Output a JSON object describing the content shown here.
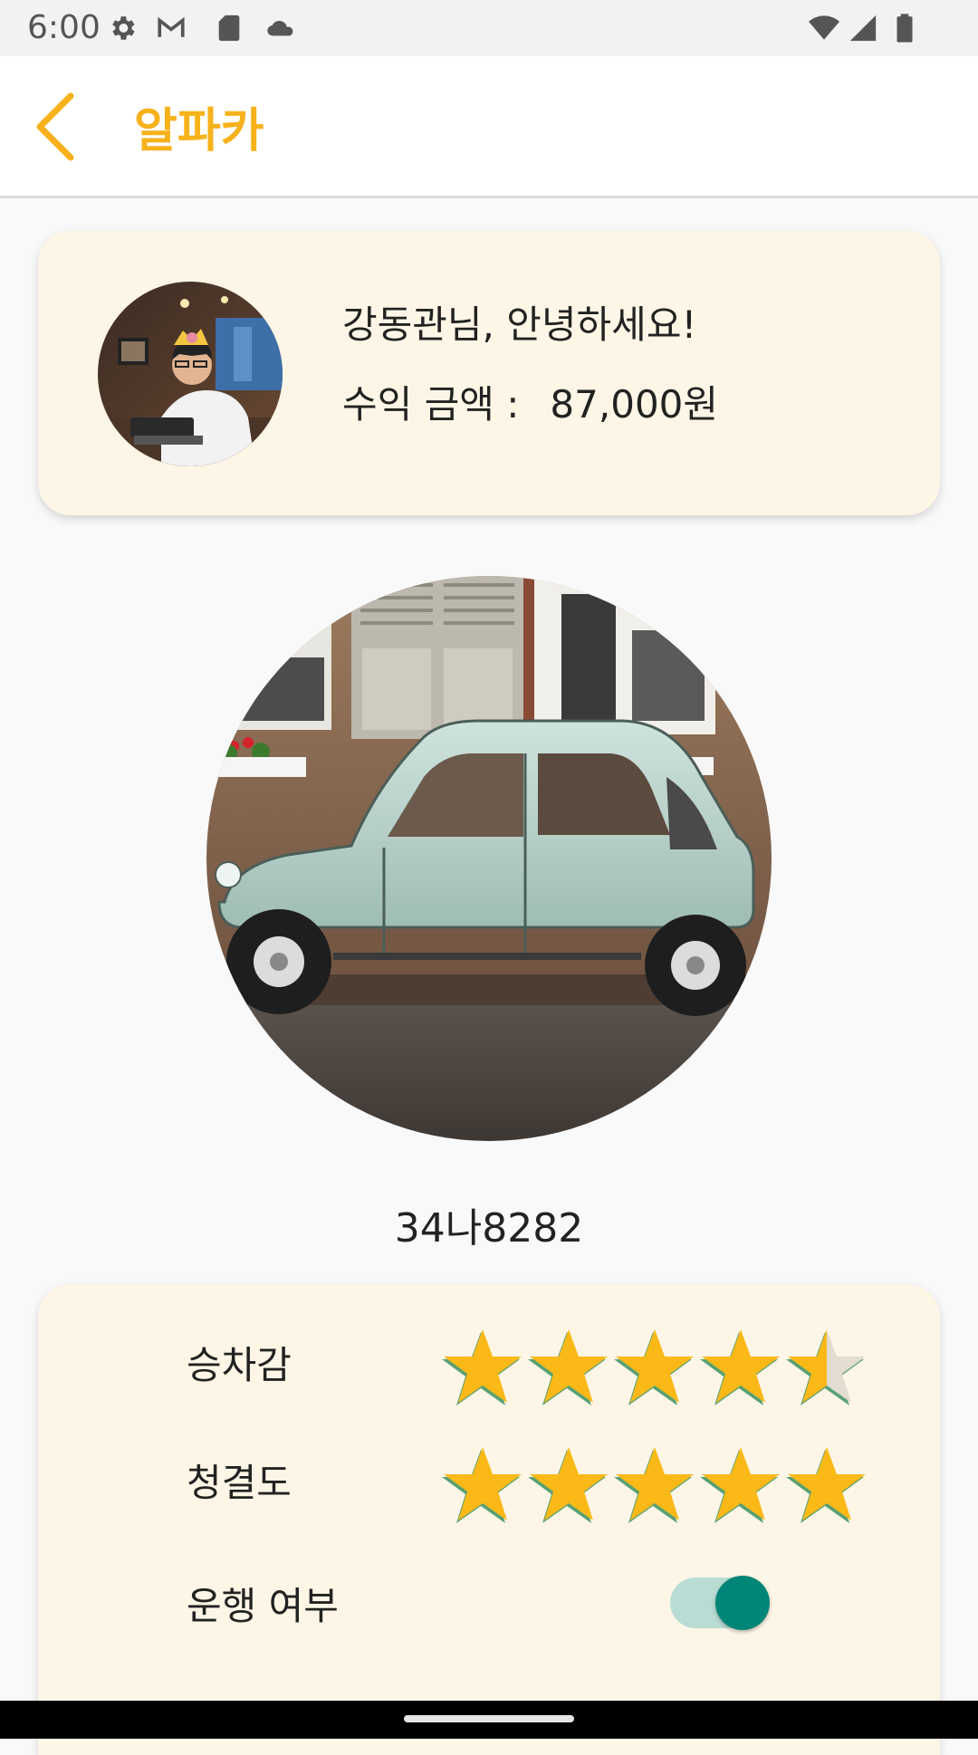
{
  "status_bar": {
    "time": "6:00",
    "left_icons": [
      "gear-icon",
      "gmail-icon",
      "sd-card-icon",
      "cloud-icon"
    ],
    "right_icons": [
      "wifi-icon",
      "cell-signal-icon",
      "battery-icon"
    ]
  },
  "app_bar": {
    "title": "알파카",
    "back_icon": "chevron-left-icon",
    "accent_color": "#f7b21b"
  },
  "profile": {
    "greeting": "강동관님, 안녕하세요!",
    "earnings_label": "수익 금액 :",
    "earnings_value": "87,000원"
  },
  "car": {
    "plate": "34나8282"
  },
  "ratings": {
    "ride_label": "승차감",
    "ride_value": 4.5,
    "clean_label": "청결도",
    "clean_value": 5,
    "max_stars": 5,
    "operating_label": "운행 여부",
    "operating_on": true
  }
}
